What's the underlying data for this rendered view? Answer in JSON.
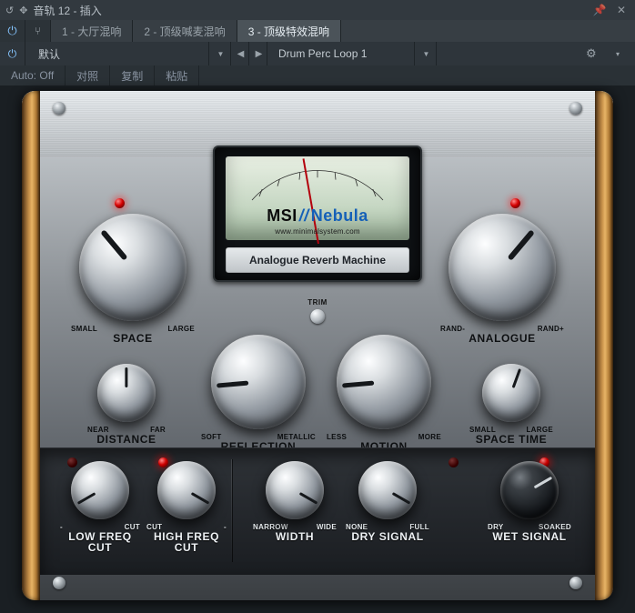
{
  "window": {
    "title": "音轨 12 - 插入",
    "pin_icon": "pin-icon",
    "close_icon": "close-icon"
  },
  "tabs": {
    "items": [
      {
        "label": "1 - 大厅混响",
        "active": false
      },
      {
        "label": "2 - 顶级喊麦混响",
        "active": false
      },
      {
        "label": "3 - 顶级特效混响",
        "active": true
      }
    ]
  },
  "toolbar": {
    "preset": "默认",
    "prev": "◀",
    "next": "▶",
    "source": "Drum Perc Loop 1",
    "gear": "⚙"
  },
  "autobar": {
    "auto_label": "Auto:",
    "auto_state": "Off",
    "compare": "对照",
    "copy": "复制",
    "paste": "粘贴"
  },
  "plugin": {
    "brand_a": "MSI",
    "brand_sep": "//",
    "brand_b": "Nebula",
    "brand_url": "www.minimalsystem.com",
    "plate": "Analogue Reverb Machine",
    "trim_label": "TRIM",
    "knobs": {
      "space": {
        "name": "SPACE",
        "left": "SMALL",
        "right": "LARGE",
        "angle": -40
      },
      "analogue": {
        "name": "ANALOGUE",
        "left": "RAND-",
        "right": "RAND+",
        "angle": 40
      },
      "distance": {
        "name": "DISTANCE",
        "left": "NEAR",
        "right": "FAR",
        "angle": 0
      },
      "spacetime": {
        "name": "SPACE TIME",
        "left": "SMALL",
        "right": "LARGE",
        "angle": 20
      },
      "reflection": {
        "name": "REFLECTION",
        "left": "SOFT",
        "right": "METALLIC",
        "angle": -95
      },
      "motion": {
        "name": "MOTION",
        "left": "LESS",
        "right": "MORE",
        "angle": -95
      },
      "lowcut": {
        "name": "LOW FREQ",
        "sub": "CUT",
        "left": "-",
        "right": "CUT",
        "angle": -120
      },
      "highcut": {
        "name": "HIGH FREQ",
        "sub": "CUT",
        "left": "CUT",
        "right": "-",
        "angle": 120
      },
      "width": {
        "name": "WIDTH",
        "left": "NARROW",
        "right": "WIDE",
        "angle": 120
      },
      "dry": {
        "name": "DRY SIGNAL",
        "left": "NONE",
        "right": "FULL",
        "angle": 120
      },
      "wet": {
        "name": "WET SIGNAL",
        "left": "DRY",
        "right": "SOAKED",
        "angle": 60
      }
    }
  }
}
